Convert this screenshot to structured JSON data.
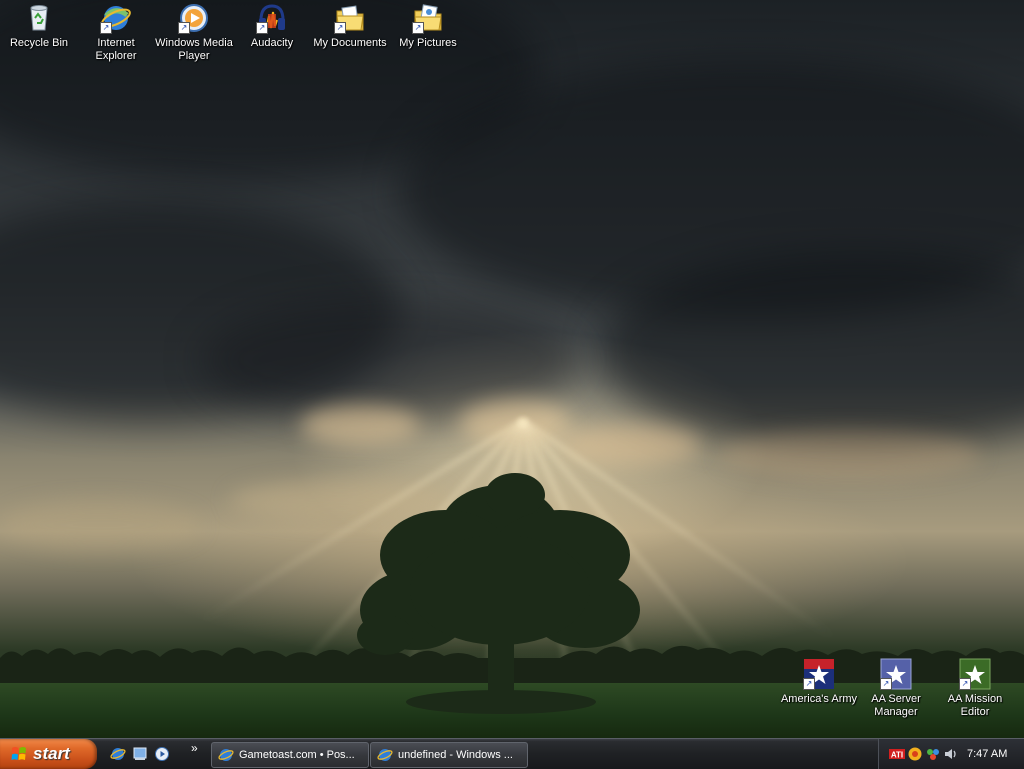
{
  "desktop_icons": [
    {
      "label": "Recycle Bin",
      "icon": "recycle-bin-icon"
    },
    {
      "label": "Internet Explorer",
      "icon": "internet-explorer-icon"
    },
    {
      "label": "Windows Media Player",
      "icon": "windows-media-player-icon"
    },
    {
      "label": "Audacity",
      "icon": "audacity-icon"
    },
    {
      "label": "My Documents",
      "icon": "my-documents-icon"
    },
    {
      "label": "My Pictures",
      "icon": "my-pictures-icon"
    },
    {
      "label": "America's Army",
      "icon": "americas-army-icon"
    },
    {
      "label": "AA Server Manager",
      "icon": "aa-server-manager-icon"
    },
    {
      "label": "AA Mission Editor",
      "icon": "aa-mission-editor-icon"
    }
  ],
  "taskbar": {
    "start_label": "start",
    "quick_launch": [
      "internet-explorer-icon",
      "show-desktop-icon",
      "windows-media-player-icon"
    ],
    "more_label": "»",
    "tasks": [
      {
        "label": "Gametoast.com • Pos...",
        "icon": "internet-explorer-icon"
      },
      {
        "label": "undefined - Windows ...",
        "icon": "internet-explorer-icon"
      }
    ],
    "tray_icons": [
      "ati-icon",
      "messenger-icon",
      "network-icon",
      "volume-icon"
    ],
    "ati_label": "ATI",
    "clock": "7:47 AM"
  }
}
